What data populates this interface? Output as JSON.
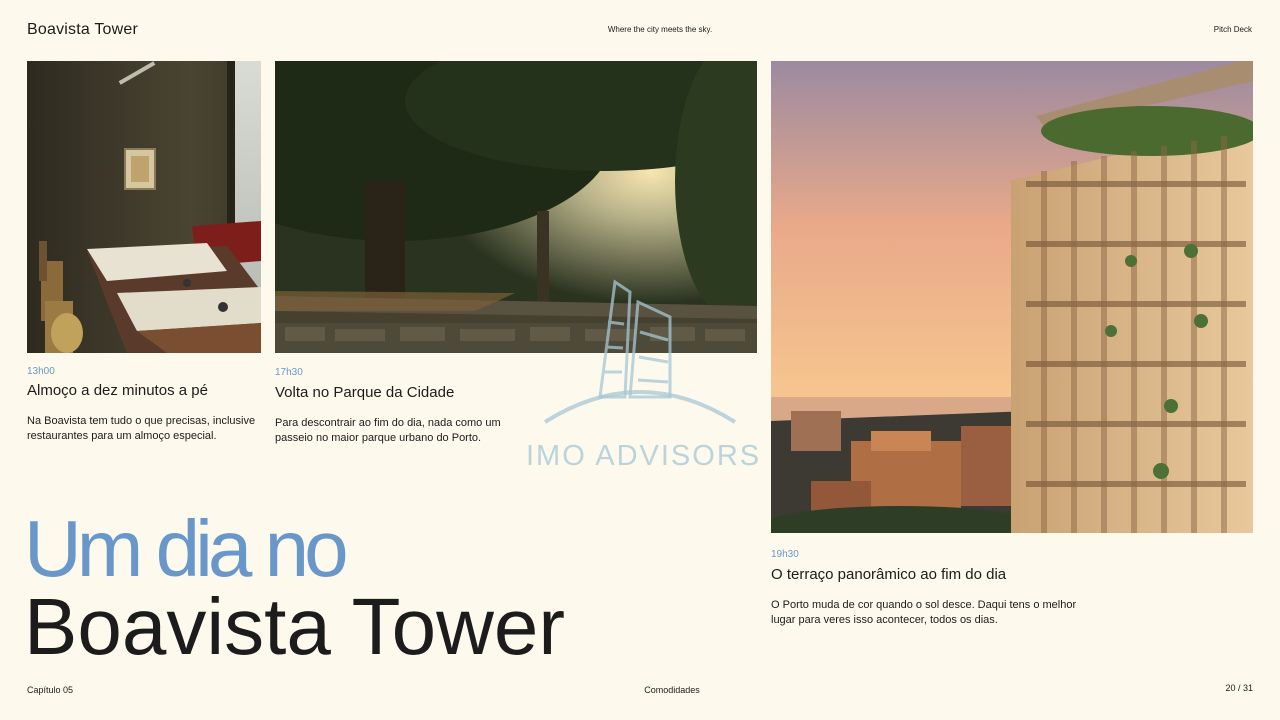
{
  "header": {
    "title": "Boavista Tower",
    "tagline": "Where the city meets the sky.",
    "doc_type": "Pitch Deck"
  },
  "cards": [
    {
      "time": "13h00",
      "title": "Almoço a dez minutos a pé",
      "text_line1": "Na Boavista tem tudo o que precisas, inclusive",
      "text_line2": "restaurantes para um almoço especial."
    },
    {
      "time": "17h30",
      "title": "Volta no Parque da Cidade",
      "text_line1": "Para descontrair ao fim do dia, nada como um",
      "text_line2": "passeio no maior parque urbano do Porto."
    },
    {
      "time": "19h30",
      "title": "O terraço panorâmico ao fim do dia",
      "text_line1": "O Porto muda de cor quando o sol desce. Daqui tens o melhor",
      "text_line2": "lugar para veres isso acontecer, todos os dias."
    }
  ],
  "hero": {
    "line1": "Um dia no",
    "line2": "Boavista Tower"
  },
  "footer": {
    "chapter": "Capítulo 05",
    "section": "Comodidades",
    "page": "20 / 31"
  },
  "watermark": {
    "text": "IMO ADVISORS"
  },
  "colors": {
    "background": "#fdf9ec",
    "accent_blue": "#6a97c9",
    "text": "#1c1c1c"
  }
}
